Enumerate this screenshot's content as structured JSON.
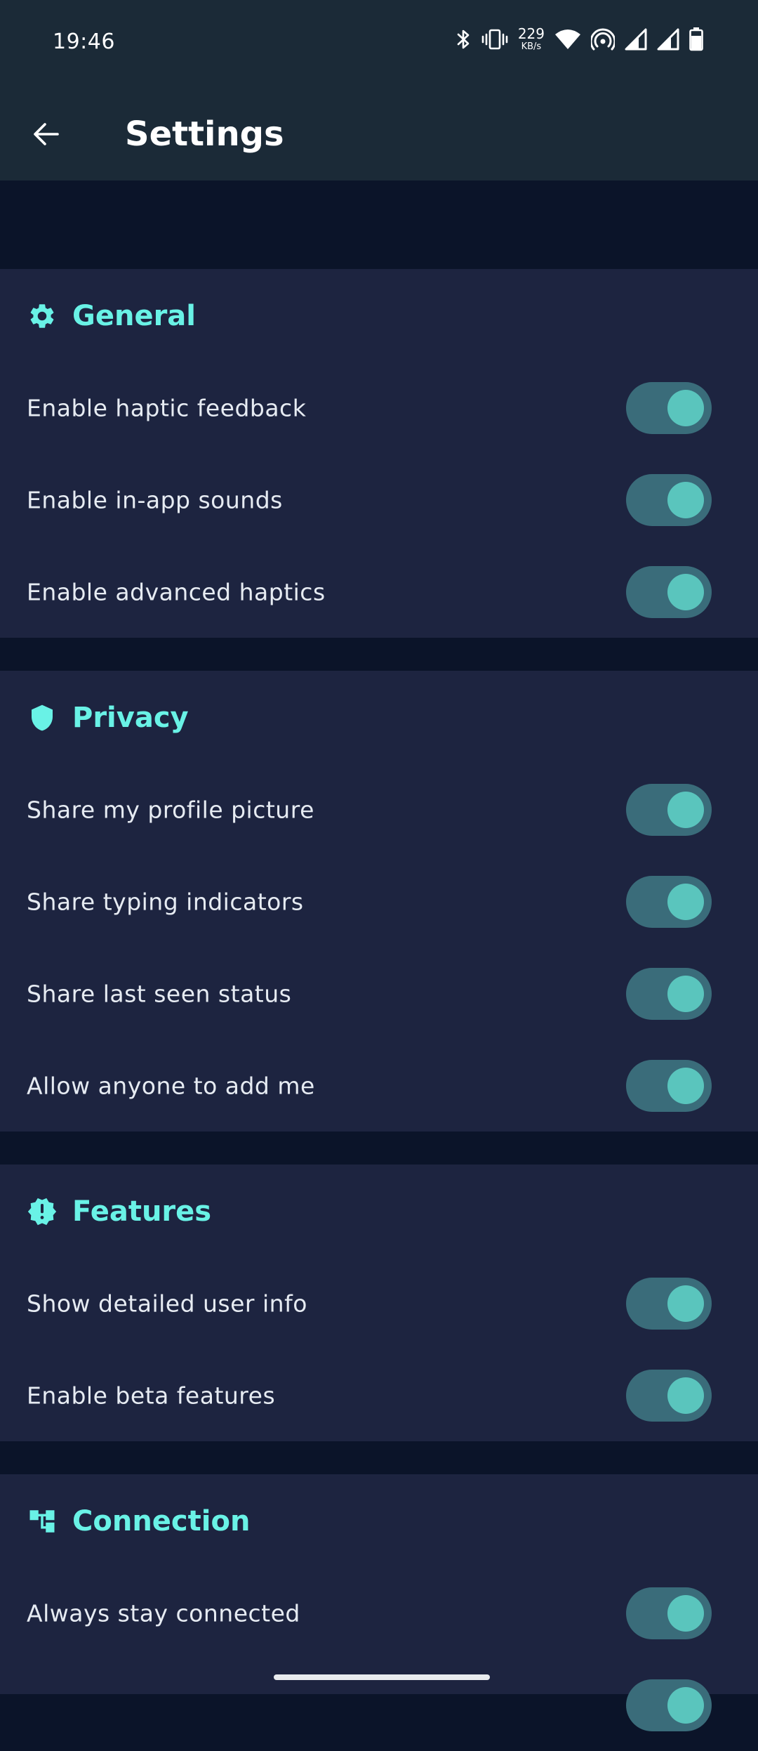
{
  "status_bar": {
    "time": "19:46",
    "net_speed_value": "229",
    "net_speed_unit": "KB/s",
    "icons": [
      "bluetooth-icon",
      "vibrate-icon",
      "net-speed",
      "wifi-icon",
      "hotspot-icon",
      "signal-icon",
      "signal-icon",
      "battery-icon"
    ]
  },
  "app_bar": {
    "back_icon": "arrow-left-icon",
    "title": "Settings"
  },
  "colors": {
    "status_bg": "#1b2a37",
    "page_bg": "#0b1429",
    "section_bg": "#1d2440",
    "accent": "#69f2e6",
    "toggle_track": "#3a6c7a",
    "toggle_knob": "#5ac5bd"
  },
  "sections": [
    {
      "title": "General",
      "icon": "gear-icon",
      "items": [
        {
          "label": "Enable haptic feedback",
          "enabled": true
        },
        {
          "label": "Enable in-app sounds",
          "enabled": true
        },
        {
          "label": "Enable advanced haptics",
          "enabled": true
        }
      ]
    },
    {
      "title": "Privacy",
      "icon": "shield-icon",
      "items": [
        {
          "label": "Share my profile picture",
          "enabled": true
        },
        {
          "label": "Share typing indicators",
          "enabled": true
        },
        {
          "label": "Share last seen status",
          "enabled": true
        },
        {
          "label": "Allow anyone to add me",
          "enabled": true
        }
      ]
    },
    {
      "title": "Features",
      "icon": "new-releases-icon",
      "items": [
        {
          "label": "Show detailed user info",
          "enabled": true
        },
        {
          "label": "Enable beta features",
          "enabled": true
        }
      ]
    },
    {
      "title": "Connection",
      "icon": "account-tree-icon",
      "items": [
        {
          "label": "Always stay connected",
          "enabled": true
        }
      ]
    }
  ]
}
